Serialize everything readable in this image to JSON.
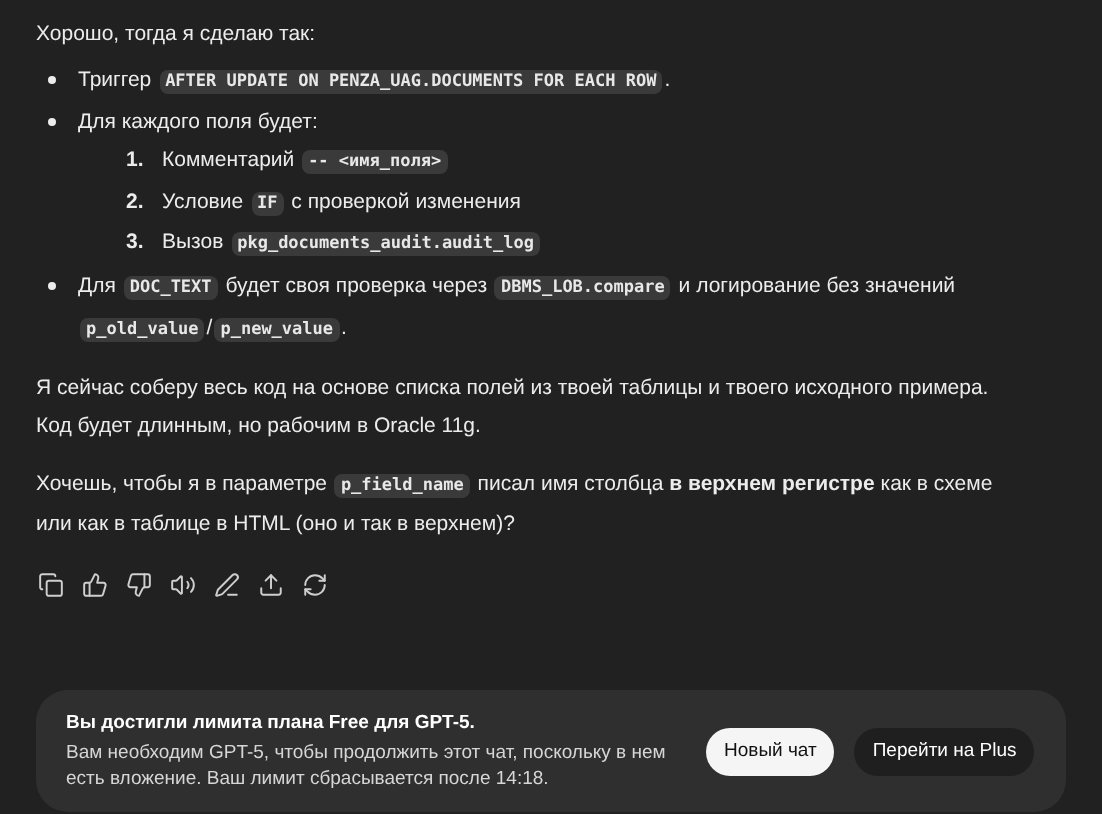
{
  "message": {
    "intro": "Хорошо, тогда я сделаю так:",
    "bullets": [
      {
        "parts": [
          {
            "kind": "text",
            "text": "Триггер "
          },
          {
            "kind": "code",
            "text": "AFTER UPDATE ON PENZA_UAG.DOCUMENTS FOR EACH ROW"
          },
          {
            "kind": "text",
            "text": "."
          }
        ]
      },
      {
        "parts": [
          {
            "kind": "text",
            "text": "Для каждого поля будет:"
          }
        ],
        "children": [
          {
            "number": "1.",
            "parts": [
              {
                "kind": "text",
                "text": "Комментарий "
              },
              {
                "kind": "code",
                "text": "-- <имя_поля>"
              }
            ]
          },
          {
            "number": "2.",
            "parts": [
              {
                "kind": "text",
                "text": "Условие "
              },
              {
                "kind": "code",
                "text": "IF"
              },
              {
                "kind": "text",
                "text": " с проверкой изменения"
              }
            ]
          },
          {
            "number": "3.",
            "parts": [
              {
                "kind": "text",
                "text": "Вызов "
              },
              {
                "kind": "code",
                "text": "pkg_documents_audit.audit_log"
              }
            ]
          }
        ]
      },
      {
        "parts": [
          {
            "kind": "text",
            "text": "Для "
          },
          {
            "kind": "code",
            "text": "DOC_TEXT"
          },
          {
            "kind": "text",
            "text": " будет своя проверка через "
          },
          {
            "kind": "code",
            "text": "DBMS_LOB.compare"
          },
          {
            "kind": "text",
            "text": " и логирование без значений "
          },
          {
            "kind": "code",
            "text": "p_old_value"
          },
          {
            "kind": "text",
            "text": "/"
          },
          {
            "kind": "code",
            "text": "p_new_value"
          },
          {
            "kind": "text",
            "text": "."
          }
        ]
      }
    ],
    "paragraphs": [
      {
        "parts": [
          {
            "kind": "text",
            "text": "Я сейчас соберу весь код на основе списка полей из твоей таблицы и твоего исходного примера. Код будет длинным, но рабочим в Oracle 11g."
          }
        ]
      },
      {
        "parts": [
          {
            "kind": "text",
            "text": "Хочешь, чтобы я в параметре "
          },
          {
            "kind": "code",
            "text": "p_field_name"
          },
          {
            "kind": "text",
            "text": " писал имя столбца "
          },
          {
            "kind": "bold",
            "text": "в верхнем регистре"
          },
          {
            "kind": "text",
            "text": " как в схеме или как в таблице в HTML (оно и так в верхнем)?"
          }
        ]
      }
    ]
  },
  "actions": [
    {
      "kind": "copy"
    },
    {
      "kind": "like"
    },
    {
      "kind": "dislike"
    },
    {
      "kind": "speak"
    },
    {
      "kind": "edit"
    },
    {
      "kind": "share"
    },
    {
      "kind": "regenerate"
    }
  ],
  "banner": {
    "title": "Вы достигли лимита плана Free для GPT-5.",
    "text": "Вам необходим GPT-5, чтобы продолжить этот чат, поскольку в нем есть вложение. Ваш лимит сбрасывается после 14:18.",
    "buttons": [
      {
        "label": "Новый чат",
        "kind": "primary"
      },
      {
        "label": "Перейти на Plus",
        "kind": "secondary"
      }
    ]
  }
}
